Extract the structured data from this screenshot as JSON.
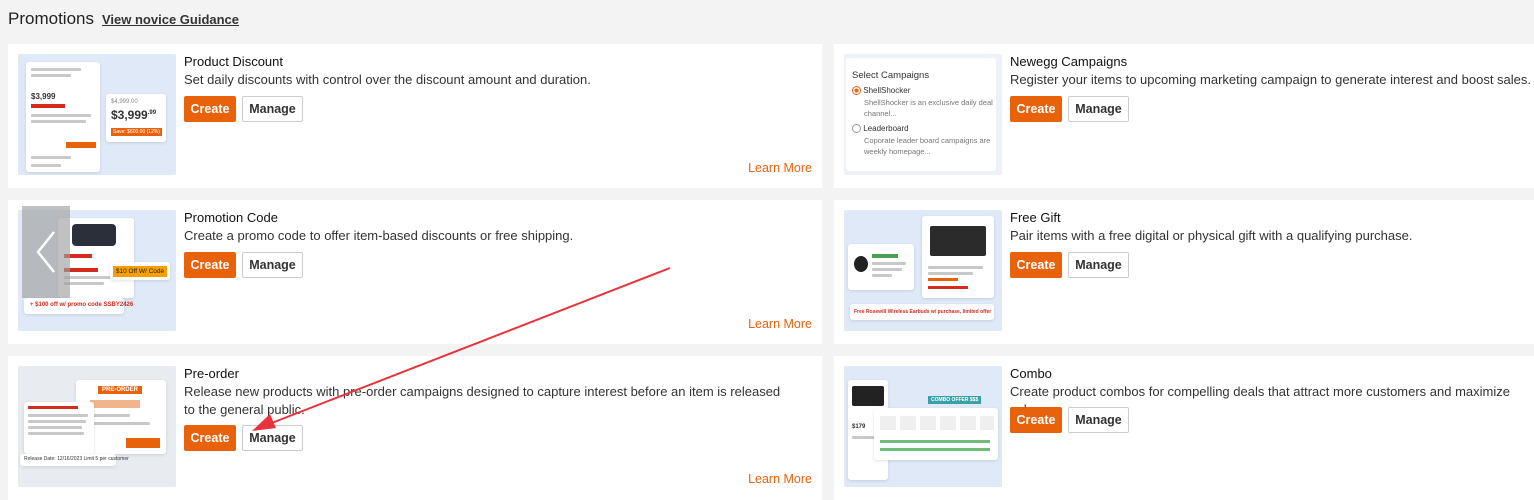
{
  "header": {
    "title": "Promotions",
    "guidance_link": "View novice Guidance"
  },
  "cards": {
    "product_discount": {
      "title": "Product Discount",
      "description": "Set daily discounts with control over the discount amount and duration.",
      "create_label": "Create",
      "manage_label": "Manage",
      "learn_more": "Learn More",
      "thumb": {
        "price_old": "$4,999.00",
        "price": "$3,999",
        "cents": ".99",
        "save": "Save: $600.00 (12%)",
        "small_price": "$3,999"
      }
    },
    "newegg_campaigns": {
      "title": "Newegg Campaigns",
      "description": "Register your items to upcoming marketing campaign to generate interest and boost sales.",
      "create_label": "Create",
      "manage_label": "Manage",
      "thumb": {
        "heading": "Select Campaigns",
        "option1": "ShellShocker",
        "option1_desc1": "ShellShocker is an exclusive daily deal",
        "option1_desc2": "channel...",
        "option2": "Leaderboard",
        "option2_desc1": "Coporate leader board campaigns are",
        "option2_desc2": "weekly homepage..."
      }
    },
    "promotion_code": {
      "title": "Promotion Code",
      "description": "Create a promo code to offer item-based discounts or free shipping.",
      "create_label": "Create",
      "manage_label": "Manage",
      "learn_more": "Learn More",
      "thumb": {
        "badge": "$10 Off W/ Code",
        "banner": "+ $100 off w/ promo code SSBY2426"
      }
    },
    "free_gift": {
      "title": "Free Gift",
      "description": "Pair items with a free digital or physical gift with a qualifying purchase.",
      "create_label": "Create",
      "manage_label": "Manage",
      "thumb": {
        "banner": "Free Rosewill Wireless Earbuds w/ purchase, limited offer"
      }
    },
    "pre_order": {
      "title": "Pre-order",
      "description": "Release new products with pre-order campaigns designed to capture interest before an item is released to the general public.",
      "create_label": "Create",
      "manage_label": "Manage",
      "learn_more": "Learn More",
      "thumb": {
        "badge": "PRE-ORDER",
        "release": "Release Date: 12/16/2023  Limit 5 per customer"
      }
    },
    "combo": {
      "title": "Combo",
      "description": "Create product combos for compelling deals that attract more customers and maximize sales.",
      "create_label": "Create",
      "manage_label": "Manage",
      "thumb": {
        "badge": "COMBO OFFER $$$",
        "price": "$179"
      }
    }
  },
  "colors": {
    "accent": "#e8620c",
    "annotation_arrow": "#e8323c"
  }
}
